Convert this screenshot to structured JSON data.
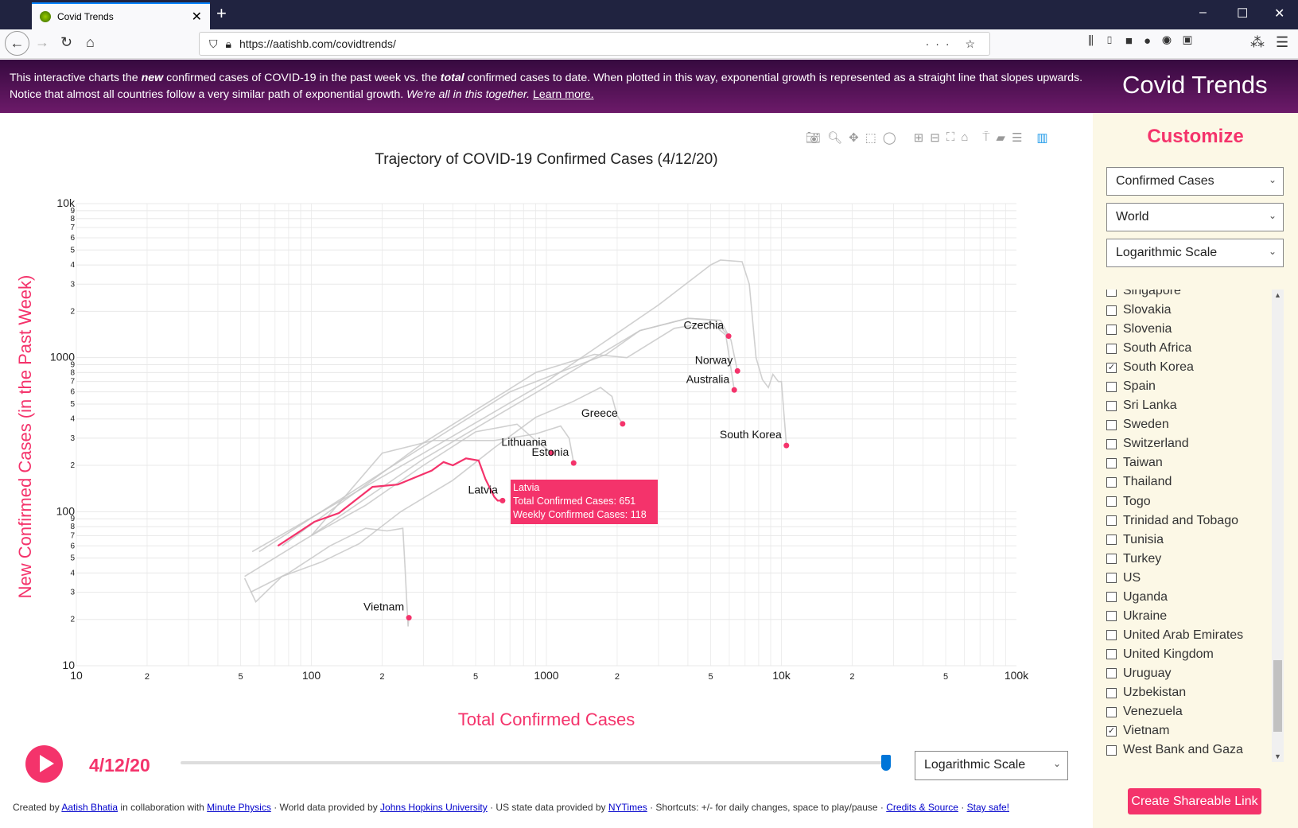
{
  "browser": {
    "tab_title": "Covid Trends",
    "url": "https://aatishb.com/covidtrends/"
  },
  "banner": {
    "intro_1": "This interactive charts the ",
    "new": "new",
    "intro_2": " confirmed cases of COVID-19 in the past week vs. the ",
    "total": "total",
    "intro_3": " confirmed cases to date. When plotted in this way, exponential growth is represented as a straight line that slopes upwards. Notice that almost all countries follow a very similar path of exponential growth. ",
    "together": "We're all in this together.",
    "learn_more": "Learn more.",
    "brand": "Covid Trends"
  },
  "sidebar": {
    "title": "Customize",
    "selects": [
      "Confirmed Cases",
      "World",
      "Logarithmic Scale"
    ],
    "countries": [
      {
        "name": "Singapore",
        "checked": false
      },
      {
        "name": "Slovakia",
        "checked": false
      },
      {
        "name": "Slovenia",
        "checked": false
      },
      {
        "name": "South Africa",
        "checked": false
      },
      {
        "name": "South Korea",
        "checked": true
      },
      {
        "name": "Spain",
        "checked": false
      },
      {
        "name": "Sri Lanka",
        "checked": false
      },
      {
        "name": "Sweden",
        "checked": false
      },
      {
        "name": "Switzerland",
        "checked": false
      },
      {
        "name": "Taiwan",
        "checked": false
      },
      {
        "name": "Thailand",
        "checked": false
      },
      {
        "name": "Togo",
        "checked": false
      },
      {
        "name": "Trinidad and Tobago",
        "checked": false
      },
      {
        "name": "Tunisia",
        "checked": false
      },
      {
        "name": "Turkey",
        "checked": false
      },
      {
        "name": "US",
        "checked": false
      },
      {
        "name": "Uganda",
        "checked": false
      },
      {
        "name": "Ukraine",
        "checked": false
      },
      {
        "name": "United Arab Emirates",
        "checked": false
      },
      {
        "name": "United Kingdom",
        "checked": false
      },
      {
        "name": "Uruguay",
        "checked": false
      },
      {
        "name": "Uzbekistan",
        "checked": false
      },
      {
        "name": "Venezuela",
        "checked": false
      },
      {
        "name": "Vietnam",
        "checked": true
      },
      {
        "name": "West Bank and Gaza",
        "checked": false
      }
    ],
    "share_label": "Create Shareable Link"
  },
  "controls": {
    "date": "4/12/20",
    "slider_fraction": 1.0,
    "scale_select": "Logarithmic Scale"
  },
  "footer": {
    "t1": "Created by ",
    "a1": "Aatish Bhatia",
    "t2": " in collaboration with ",
    "a2": "Minute Physics",
    "t3": " · World data provided by ",
    "a3": "Johns Hopkins University",
    "t4": " · US state data provided by ",
    "a4": "NYTimes",
    "t5": " · Shortcuts: +/- for daily changes, space to play/pause · ",
    "a5": "Credits & Source",
    "t6": " · ",
    "a6": "Stay safe!"
  },
  "colors": {
    "accent": "#f4336b",
    "banner": "#4a1052",
    "sidebar": "#fcf8e6",
    "line": "#cccccc"
  },
  "chart_data": {
    "type": "line",
    "title": "Trajectory of COVID-19 Confirmed Cases (4/12/20)",
    "xlabel": "Total Confirmed Cases",
    "ylabel": "New Confirmed Cases (in the Past Week)",
    "xscale": "log",
    "yscale": "log",
    "xlim": [
      10,
      100000
    ],
    "ylim": [
      10,
      10000
    ],
    "grid": true,
    "xticks": [
      {
        "v": 10,
        "t": "10"
      },
      {
        "v": 20,
        "t": "2"
      },
      {
        "v": 50,
        "t": "5"
      },
      {
        "v": 100,
        "t": "100"
      },
      {
        "v": 200,
        "t": "2"
      },
      {
        "v": 500,
        "t": "5"
      },
      {
        "v": 1000,
        "t": "1000"
      },
      {
        "v": 2000,
        "t": "2"
      },
      {
        "v": 5000,
        "t": "5"
      },
      {
        "v": 10000,
        "t": "10k"
      },
      {
        "v": 20000,
        "t": "2"
      },
      {
        "v": 50000,
        "t": "5"
      },
      {
        "v": 100000,
        "t": "100k"
      }
    ],
    "yticks": [
      {
        "v": 10,
        "t": "10"
      },
      {
        "v": 20,
        "t": "2"
      },
      {
        "v": 30,
        "t": "3"
      },
      {
        "v": 40,
        "t": "4"
      },
      {
        "v": 50,
        "t": "5"
      },
      {
        "v": 60,
        "t": "6"
      },
      {
        "v": 70,
        "t": "7"
      },
      {
        "v": 80,
        "t": "8"
      },
      {
        "v": 90,
        "t": "9"
      },
      {
        "v": 100,
        "t": "100"
      },
      {
        "v": 200,
        "t": "2"
      },
      {
        "v": 300,
        "t": "3"
      },
      {
        "v": 400,
        "t": "4"
      },
      {
        "v": 500,
        "t": "5"
      },
      {
        "v": 600,
        "t": "6"
      },
      {
        "v": 700,
        "t": "7"
      },
      {
        "v": 800,
        "t": "8"
      },
      {
        "v": 900,
        "t": "9"
      },
      {
        "v": 1000,
        "t": "1000"
      },
      {
        "v": 2000,
        "t": "2"
      },
      {
        "v": 3000,
        "t": "3"
      },
      {
        "v": 4000,
        "t": "4"
      },
      {
        "v": 5000,
        "t": "5"
      },
      {
        "v": 6000,
        "t": "6"
      },
      {
        "v": 7000,
        "t": "7"
      },
      {
        "v": 8000,
        "t": "8"
      },
      {
        "v": 9000,
        "t": "9"
      },
      {
        "v": 10000,
        "t": "10k"
      }
    ],
    "series": [
      {
        "name": "South Korea",
        "points": [
          [
            56,
            55
          ],
          [
            300,
            240
          ],
          [
            1000,
            700
          ],
          [
            3000,
            2200
          ],
          [
            5000,
            4000
          ],
          [
            5500,
            4300
          ],
          [
            6800,
            4200
          ],
          [
            7300,
            3000
          ],
          [
            7800,
            1000
          ],
          [
            8300,
            720
          ],
          [
            8800,
            640
          ],
          [
            9200,
            780
          ],
          [
            9700,
            700
          ],
          [
            10000,
            700
          ],
          [
            10500,
            269
          ]
        ]
      },
      {
        "name": "Czechia",
        "points": [
          [
            52,
            38
          ],
          [
            100,
            70
          ],
          [
            300,
            220
          ],
          [
            1000,
            650
          ],
          [
            2500,
            1500
          ],
          [
            4000,
            1800
          ],
          [
            5200,
            1750
          ],
          [
            5960,
            1380
          ]
        ]
      },
      {
        "name": "Norway",
        "points": [
          [
            60,
            55
          ],
          [
            200,
            180
          ],
          [
            700,
            600
          ],
          [
            1300,
            870
          ],
          [
            1800,
            1050
          ],
          [
            2500,
            1500
          ],
          [
            4000,
            1800
          ],
          [
            5500,
            1750
          ],
          [
            6100,
            1300
          ],
          [
            6500,
            820
          ]
        ]
      },
      {
        "name": "Australia",
        "points": [
          [
            75,
            60
          ],
          [
            300,
            280
          ],
          [
            900,
            800
          ],
          [
            1600,
            1050
          ],
          [
            2200,
            1000
          ],
          [
            3500,
            1550
          ],
          [
            5000,
            1700
          ],
          [
            5800,
            1400
          ],
          [
            6300,
            617
          ]
        ]
      },
      {
        "name": "Greece",
        "points": [
          [
            52,
            37
          ],
          [
            58,
            26
          ],
          [
            75,
            38
          ],
          [
            110,
            47
          ],
          [
            160,
            62
          ],
          [
            240,
            100
          ],
          [
            400,
            160
          ],
          [
            600,
            260
          ],
          [
            900,
            410
          ],
          [
            1300,
            520
          ],
          [
            1700,
            640
          ],
          [
            1900,
            560
          ],
          [
            2000,
            420
          ],
          [
            2110,
            372
          ]
        ]
      },
      {
        "name": "Lithuania",
        "points": [
          [
            100,
            70
          ],
          [
            170,
            110
          ],
          [
            300,
            200
          ],
          [
            500,
            330
          ],
          [
            750,
            370
          ],
          [
            900,
            290
          ],
          [
            1050,
            241
          ]
        ]
      },
      {
        "name": "Estonia",
        "points": [
          [
            100,
            70
          ],
          [
            200,
            240
          ],
          [
            330,
            290
          ],
          [
            600,
            290
          ],
          [
            900,
            320
          ],
          [
            1150,
            360
          ],
          [
            1250,
            300
          ],
          [
            1306,
            207
          ]
        ]
      },
      {
        "name": "Vietnam",
        "points": [
          [
            55,
            30
          ],
          [
            80,
            40
          ],
          [
            120,
            60
          ],
          [
            170,
            78
          ],
          [
            210,
            75
          ],
          [
            245,
            78
          ],
          [
            250,
            45
          ],
          [
            255,
            25
          ],
          [
            258,
            18
          ],
          [
            260,
            20.5
          ]
        ]
      },
      {
        "name": "Latvia",
        "highlight": true,
        "points": [
          [
            72,
            60
          ],
          [
            103,
            86
          ],
          [
            131,
            98
          ],
          [
            182,
            145
          ],
          [
            233,
            150
          ],
          [
            325,
            185
          ],
          [
            365,
            210
          ],
          [
            400,
            200
          ],
          [
            455,
            222
          ],
          [
            515,
            215
          ],
          [
            550,
            163
          ],
          [
            600,
            125
          ],
          [
            620,
            118
          ],
          [
            651,
            118
          ]
        ]
      }
    ],
    "labels": [
      {
        "name": "Czechia",
        "x": 5960,
        "y": 1380
      },
      {
        "name": "Norway",
        "x": 6500,
        "y": 820
      },
      {
        "name": "Australia",
        "x": 6300,
        "y": 617
      },
      {
        "name": "Greece",
        "x": 2110,
        "y": 372
      },
      {
        "name": "South Korea",
        "x": 10500,
        "y": 269
      },
      {
        "name": "Lithuania",
        "x": 1050,
        "y": 241
      },
      {
        "name": "Estonia",
        "x": 1306,
        "y": 207
      },
      {
        "name": "Latvia",
        "x": 651,
        "y": 118
      },
      {
        "name": "Vietnam",
        "x": 260,
        "y": 20.5
      }
    ],
    "tooltip": {
      "name": "Latvia",
      "total": "Total Confirmed Cases: 651",
      "weekly": "Weekly Confirmed Cases: 118"
    }
  }
}
